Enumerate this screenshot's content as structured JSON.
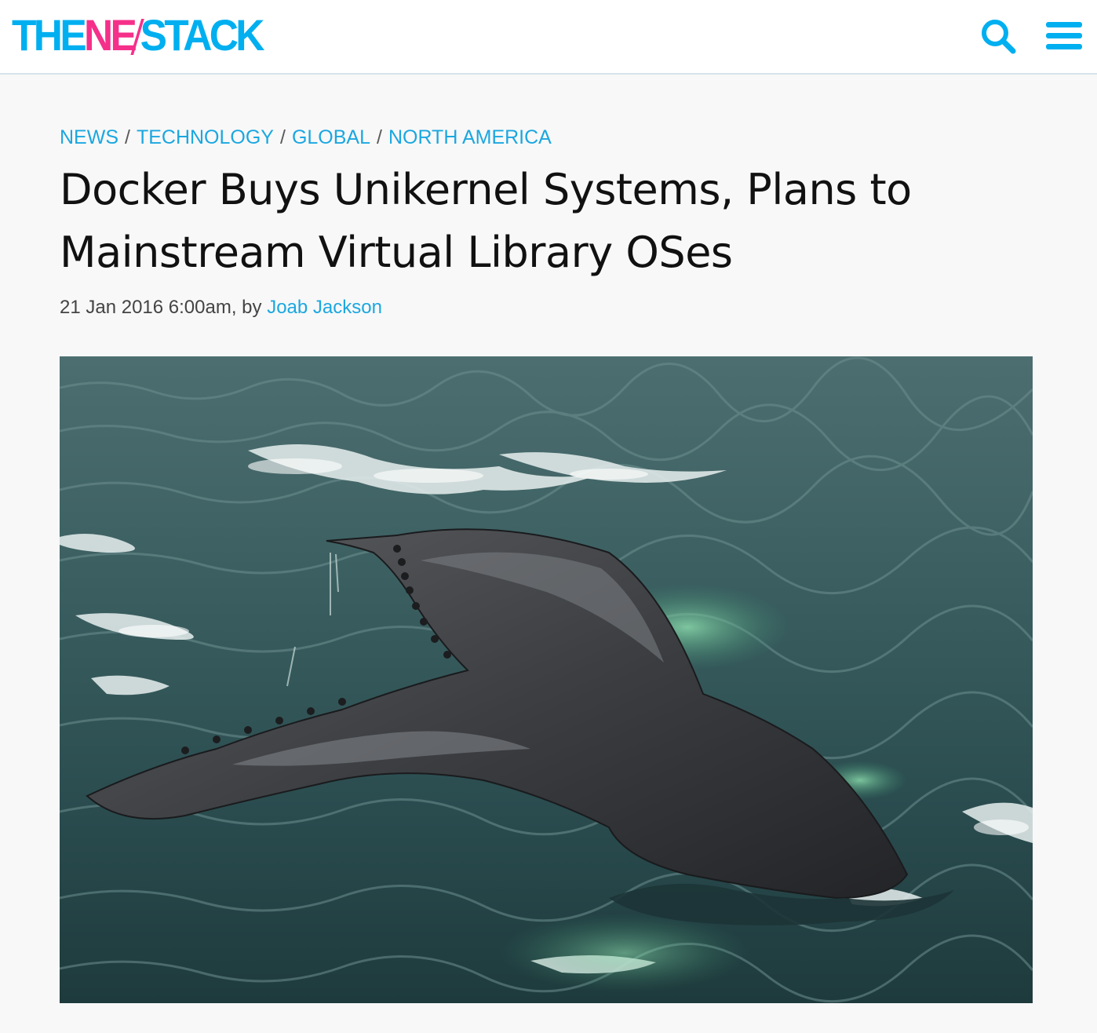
{
  "header": {
    "logo": {
      "the": "THE",
      "new": "NEW",
      "stack": "STACK"
    },
    "search_icon": "search-icon",
    "menu_icon": "hamburger-menu-icon"
  },
  "article": {
    "breadcrumb": [
      "NEWS",
      "TECHNOLOGY",
      "GLOBAL",
      "NORTH AMERICA"
    ],
    "separator": "/",
    "title": "Docker Buys Unikernel Systems, Plans to Mainstream Virtual Library OSes",
    "date": "21 Jan 2016 6:00am, by",
    "author": "Joab Jackson"
  },
  "colors": {
    "brand_blue": "#00aff0",
    "brand_pink": "#f5308a",
    "link": "#1ba7e0"
  }
}
